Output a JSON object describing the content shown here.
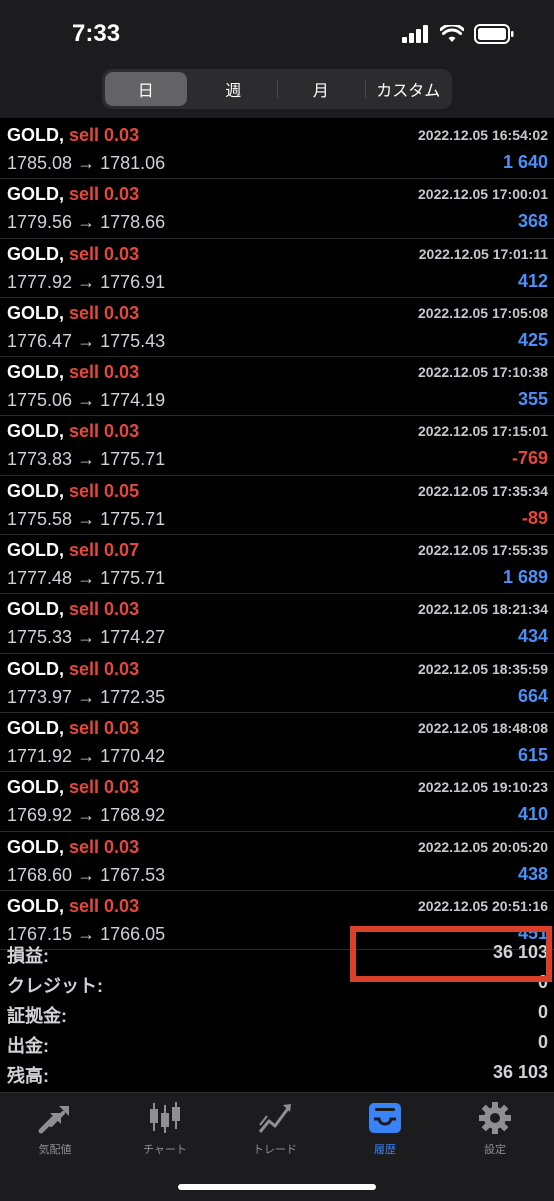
{
  "status_bar": {
    "time": "7:33"
  },
  "period_tabs": [
    {
      "label": "日",
      "active": true
    },
    {
      "label": "週",
      "active": false
    },
    {
      "label": "月",
      "active": false
    },
    {
      "label": "カスタム",
      "active": false
    }
  ],
  "deals": [
    {
      "symbol": "GOLD,",
      "side": "sell 0.03",
      "datetime": "2022.12.05 16:54:02",
      "prices": "1785.08 → 1781.06",
      "profit": "1 640",
      "sign": "pos"
    },
    {
      "symbol": "GOLD,",
      "side": "sell 0.03",
      "datetime": "2022.12.05 17:00:01",
      "prices": "1779.56 → 1778.66",
      "profit": "368",
      "sign": "pos"
    },
    {
      "symbol": "GOLD,",
      "side": "sell 0.03",
      "datetime": "2022.12.05 17:01:11",
      "prices": "1777.92 → 1776.91",
      "profit": "412",
      "sign": "pos"
    },
    {
      "symbol": "GOLD,",
      "side": "sell 0.03",
      "datetime": "2022.12.05 17:05:08",
      "prices": "1776.47 → 1775.43",
      "profit": "425",
      "sign": "pos"
    },
    {
      "symbol": "GOLD,",
      "side": "sell 0.03",
      "datetime": "2022.12.05 17:10:38",
      "prices": "1775.06 → 1774.19",
      "profit": "355",
      "sign": "pos"
    },
    {
      "symbol": "GOLD,",
      "side": "sell 0.03",
      "datetime": "2022.12.05 17:15:01",
      "prices": "1773.83 → 1775.71",
      "profit": "-769",
      "sign": "neg"
    },
    {
      "symbol": "GOLD,",
      "side": "sell 0.05",
      "datetime": "2022.12.05 17:35:34",
      "prices": "1775.58 → 1775.71",
      "profit": "-89",
      "sign": "neg"
    },
    {
      "symbol": "GOLD,",
      "side": "sell 0.07",
      "datetime": "2022.12.05 17:55:35",
      "prices": "1777.48 → 1775.71",
      "profit": "1 689",
      "sign": "pos"
    },
    {
      "symbol": "GOLD,",
      "side": "sell 0.03",
      "datetime": "2022.12.05 18:21:34",
      "prices": "1775.33 → 1774.27",
      "profit": "434",
      "sign": "pos"
    },
    {
      "symbol": "GOLD,",
      "side": "sell 0.03",
      "datetime": "2022.12.05 18:35:59",
      "prices": "1773.97 → 1772.35",
      "profit": "664",
      "sign": "pos"
    },
    {
      "symbol": "GOLD,",
      "side": "sell 0.03",
      "datetime": "2022.12.05 18:48:08",
      "prices": "1771.92 → 1770.42",
      "profit": "615",
      "sign": "pos"
    },
    {
      "symbol": "GOLD,",
      "side": "sell 0.03",
      "datetime": "2022.12.05 19:10:23",
      "prices": "1769.92 → 1768.92",
      "profit": "410",
      "sign": "pos"
    },
    {
      "symbol": "GOLD,",
      "side": "sell 0.03",
      "datetime": "2022.12.05 20:05:20",
      "prices": "1768.60 → 1767.53",
      "profit": "438",
      "sign": "pos"
    },
    {
      "symbol": "GOLD,",
      "side": "sell 0.03",
      "datetime": "2022.12.05 20:51:16",
      "prices": "1767.15 → 1766.05",
      "profit": "451",
      "sign": "pos"
    }
  ],
  "summary": [
    {
      "label": "損益:",
      "value": "36 103"
    },
    {
      "label": "クレジット:",
      "value": "0"
    },
    {
      "label": "証拠金:",
      "value": "0"
    },
    {
      "label": "出金:",
      "value": "0"
    },
    {
      "label": "残高:",
      "value": "36 103"
    }
  ],
  "tab_bar": [
    {
      "label": "気配値",
      "icon": "quotes-arrows-icon",
      "active": false
    },
    {
      "label": "チャート",
      "icon": "candlestick-chart-icon",
      "active": false
    },
    {
      "label": "トレード",
      "icon": "trade-line-icon",
      "active": false
    },
    {
      "label": "履歴",
      "icon": "history-inbox-icon",
      "active": true
    },
    {
      "label": "設定",
      "icon": "settings-gear-icon",
      "active": false
    }
  ],
  "colors": {
    "sell": "#e5473a",
    "profit_positive": "#4a90f7",
    "profit_negative": "#e5473a",
    "highlight_box": "#d9402a",
    "active_tab": "#3a82f7"
  }
}
